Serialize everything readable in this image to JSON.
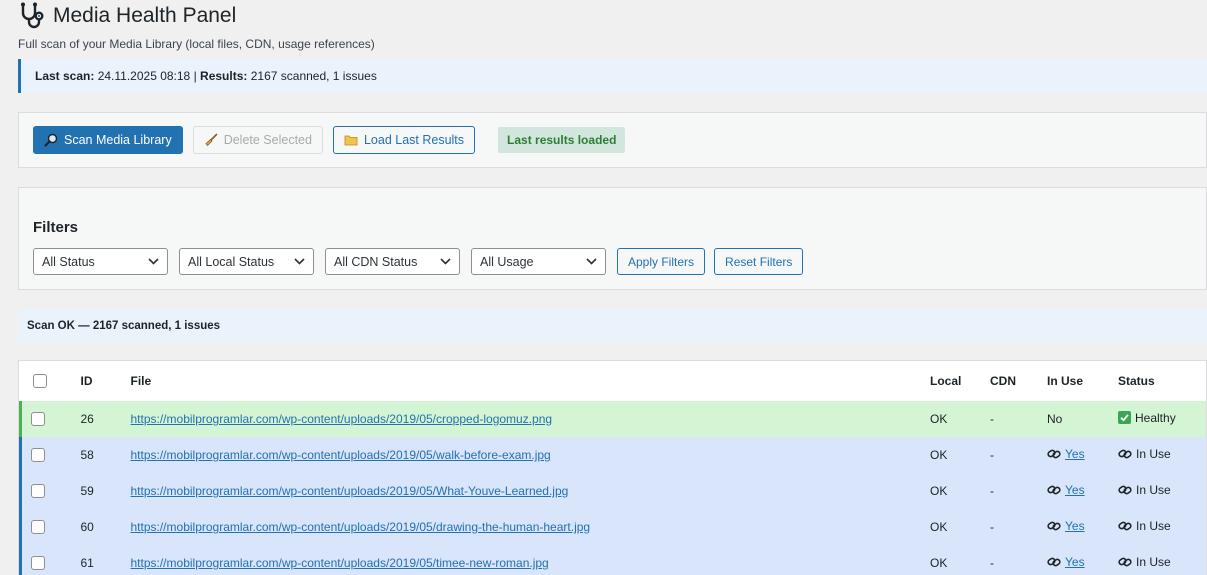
{
  "header": {
    "title": "Media Health Panel",
    "subtitle": "Full scan of your Media Library (local files, CDN, usage references)"
  },
  "notice": {
    "last_scan_label": "Last scan:",
    "last_scan_value": "24.11.2025 08:18",
    "separator": "|",
    "results_label": "Results:",
    "results_value": "2167 scanned, 1 issues"
  },
  "actions": {
    "scan_label": "Scan Media Library",
    "delete_label": "Delete Selected",
    "load_label": "Load Last Results",
    "status_badge": "Last results loaded"
  },
  "filters": {
    "title": "Filters",
    "status": "All Status",
    "local_status": "All Local Status",
    "cdn_status": "All CDN Status",
    "usage": "All Usage",
    "apply_label": "Apply Filters",
    "reset_label": "Reset Filters"
  },
  "summary": "Scan OK — 2167 scanned, 1 issues",
  "table": {
    "headers": {
      "id": "ID",
      "file": "File",
      "local": "Local",
      "cdn": "CDN",
      "in_use": "In Use",
      "status": "Status"
    },
    "rows": [
      {
        "id": "26",
        "file": "https://mobilprogramlar.com/wp-content/uploads/2019/05/cropped-logomuz.png",
        "local": "OK",
        "cdn": "-",
        "in_use": "No",
        "status": "Healthy",
        "kind": "healthy"
      },
      {
        "id": "58",
        "file": "https://mobilprogramlar.com/wp-content/uploads/2019/05/walk-before-exam.jpg",
        "local": "OK",
        "cdn": "-",
        "in_use": "Yes",
        "status": "In Use",
        "kind": "inuse"
      },
      {
        "id": "59",
        "file": "https://mobilprogramlar.com/wp-content/uploads/2019/05/What-Youve-Learned.jpg",
        "local": "OK",
        "cdn": "-",
        "in_use": "Yes",
        "status": "In Use",
        "kind": "inuse"
      },
      {
        "id": "60",
        "file": "https://mobilprogramlar.com/wp-content/uploads/2019/05/drawing-the-human-heart.jpg",
        "local": "OK",
        "cdn": "-",
        "in_use": "Yes",
        "status": "In Use",
        "kind": "inuse"
      },
      {
        "id": "61",
        "file": "https://mobilprogramlar.com/wp-content/uploads/2019/05/timee-new-roman.jpg",
        "local": "OK",
        "cdn": "-",
        "in_use": "Yes",
        "status": "In Use",
        "kind": "inuse"
      }
    ]
  },
  "icons": {
    "title": "stethoscope-icon",
    "scan": "magnifier-icon",
    "delete": "broom-icon",
    "load": "folder-icon",
    "healthy": "check-icon",
    "in_use": "link-icon"
  },
  "colors": {
    "accent": "#2271b1",
    "healthy_row": "#d4f5d4",
    "inuse_row": "#d8e5fb",
    "badge_bg": "#d1e7dd",
    "badge_text": "#2e7d32"
  }
}
